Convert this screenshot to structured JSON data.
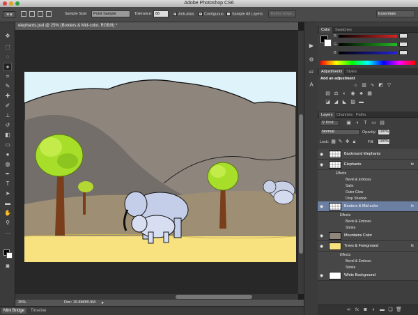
{
  "app": {
    "title": "Adobe Photoshop CS6"
  },
  "options_bar": {
    "sample_size_label": "Sample Size:",
    "sample_size_value": "Point Sample",
    "tolerance_label": "Tolerance:",
    "tolerance_value": "88",
    "anti_alias_label": "Anti-alias",
    "contiguous_label": "Contiguous",
    "sample_all_label": "Sample All Layers",
    "refine_edge_label": "Refine Edge...",
    "workspace": "Essentials"
  },
  "document": {
    "tab_title": "elephants.psd @ 25% (Borders & Mid-color, RGB/8) *",
    "zoom": "25%",
    "doc_size": "Doc: 19.8M/89.9M"
  },
  "bottom_tabs": [
    "Mini Bridge",
    "Timeline"
  ],
  "color_panel": {
    "tabs": [
      "Color",
      "Swatches"
    ],
    "channels": [
      "R",
      "G",
      "B"
    ]
  },
  "adjustments_panel": {
    "tabs": [
      "Adjustments",
      "Styles"
    ],
    "heading": "Add an adjustment"
  },
  "layers_panel": {
    "tabs": [
      "Layers",
      "Channels",
      "Paths"
    ],
    "filter_label": "Kind",
    "blend_mode": "Normal",
    "opacity_label": "Opacity:",
    "opacity_value": "100%",
    "lock_label": "Lock:",
    "fill_label": "Fill:",
    "fill_value": "100%",
    "layers": [
      "Backround Elephants",
      "Elephants",
      "Borders & Mid-color",
      "Mountains Color",
      "Trees & Foreground",
      "White Background"
    ],
    "effects_label": "Effects",
    "elephants_effects": [
      "Bevel & Emboss",
      "Satin",
      "Outer Glow",
      "Drop Shadow"
    ],
    "borders_effects": [
      "Bevel & Emboss",
      "Stroke"
    ],
    "trees_effects": [
      "Bevel & Emboss",
      "Stroke"
    ],
    "fx_label": "fx"
  },
  "colors": {
    "selected_layer": "#6b7fa3",
    "slider_red": "#d22",
    "slider_green": "#2b2",
    "slider_blue": "#22d"
  }
}
